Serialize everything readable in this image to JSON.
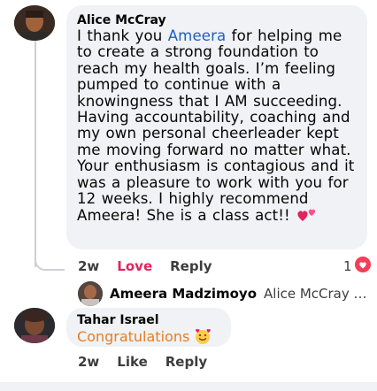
{
  "comments": [
    {
      "author": "Alice McCray",
      "text_before": "I thank you ",
      "mention": "Ameera",
      "text_after": " for helping me to create a strong foundation to reach my health goals. I’m feeling pumped to continue with a knowingness that I AM succeeding. Having accountability, coaching and my own personal cheerleader kept me moving forward no matter what. Your enthusiasm is contagious and it was a pleasure to work with you for 12 weeks. I highly recommend Ameera! She is a class act!! ",
      "emoji": "hearts-emoji",
      "time": "2w",
      "reaction_label": "Love",
      "reply_label": "Reply",
      "reaction_count": "1",
      "reaction_icon": "love-reaction-icon"
    },
    {
      "author": "Tahar Israel",
      "text": "Congratulations",
      "emoji": "smiling-face-with-hearts-emoji",
      "time": "2w",
      "like_label": "Like",
      "reply_label": "Reply"
    }
  ],
  "reply_preview": {
    "author": "Ameera Madzimoyo",
    "text": "Alice McCray t..."
  },
  "colors": {
    "mention": "#1f5fbf",
    "love": "#e0245e",
    "congrats": "#e67e22",
    "bubble": "#f0f2f5"
  }
}
